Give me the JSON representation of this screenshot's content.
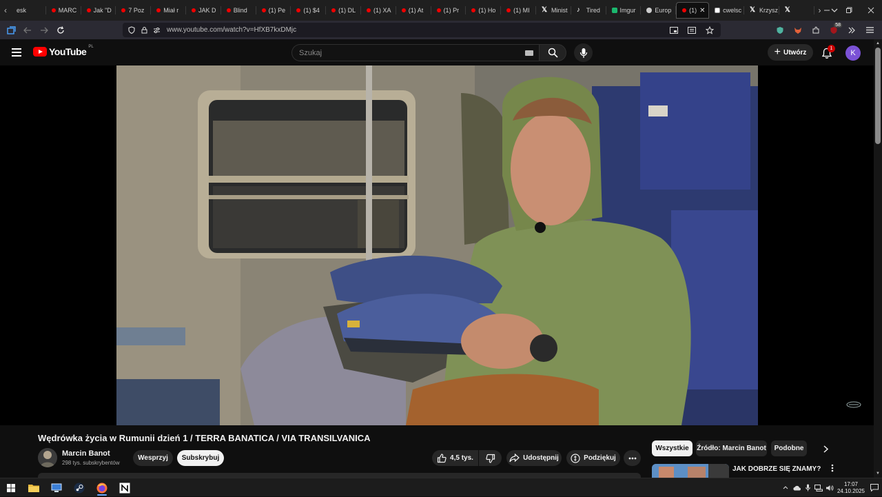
{
  "browser": {
    "tabs": [
      {
        "label": "esk",
        "favicon": "generic"
      },
      {
        "label": "MARC",
        "favicon": "youtube"
      },
      {
        "label": "Jak \"D",
        "favicon": "youtube"
      },
      {
        "label": "7 Poz",
        "favicon": "youtube"
      },
      {
        "label": "Miał r",
        "favicon": "youtube"
      },
      {
        "label": "JAK D",
        "favicon": "youtube"
      },
      {
        "label": "Blind",
        "favicon": "youtube"
      },
      {
        "label": "(1) Pe",
        "favicon": "youtube"
      },
      {
        "label": "(1) $4",
        "favicon": "youtube"
      },
      {
        "label": "(1) DL",
        "favicon": "youtube"
      },
      {
        "label": "(1) XA",
        "favicon": "youtube"
      },
      {
        "label": "(1) At",
        "favicon": "youtube"
      },
      {
        "label": "(1) Pr",
        "favicon": "youtube"
      },
      {
        "label": "(1) Ho",
        "favicon": "youtube"
      },
      {
        "label": "(1) MI",
        "favicon": "youtube"
      },
      {
        "label": "Minist",
        "favicon": "x"
      },
      {
        "label": "Tired",
        "favicon": "tiktok"
      },
      {
        "label": "Imgur",
        "favicon": "imgur"
      },
      {
        "label": "Europ",
        "favicon": "europe"
      },
      {
        "label": "(1)",
        "favicon": "youtube",
        "active": true
      },
      {
        "label": "cwelsc",
        "favicon": "sheet"
      },
      {
        "label": "Krzysz",
        "favicon": "x"
      },
      {
        "label": "",
        "favicon": "x"
      }
    ],
    "url": "www.youtube.com/watch?v=HfXB7kxDMjc",
    "extension_badge": "58"
  },
  "youtube": {
    "logo_text": "YouTube",
    "country_code": "PL",
    "search_placeholder": "Szukaj",
    "create_label": "Utwórz",
    "notification_count": "1",
    "avatar_letter": "K",
    "video": {
      "title": "Wędrówka życia w Rumunii dzień 1 / TERRA BANATICA / VIA TRANSILVANICA",
      "channel_name": "Marcin Banot",
      "subscribers": "298 tys. subskrybentów",
      "support_label": "Wesprzyj",
      "subscribe_label": "Subskrybuj",
      "likes": "4,5 tys.",
      "share_label": "Udostępnij",
      "thanks_label": "Podziękuj"
    },
    "chips": {
      "all": "Wszystkie",
      "source": "Źródło: Marcin Banot",
      "similar": "Podobne"
    },
    "recommendation": {
      "title": "JAK DOBRZE SIĘ ZNAMY?"
    }
  },
  "taskbar": {
    "time": "17:07",
    "date": "24.10.2025"
  },
  "colors": {
    "yt_red": "#ff0000",
    "background": "#0f0f0f",
    "avatar": "#7b52d6"
  }
}
